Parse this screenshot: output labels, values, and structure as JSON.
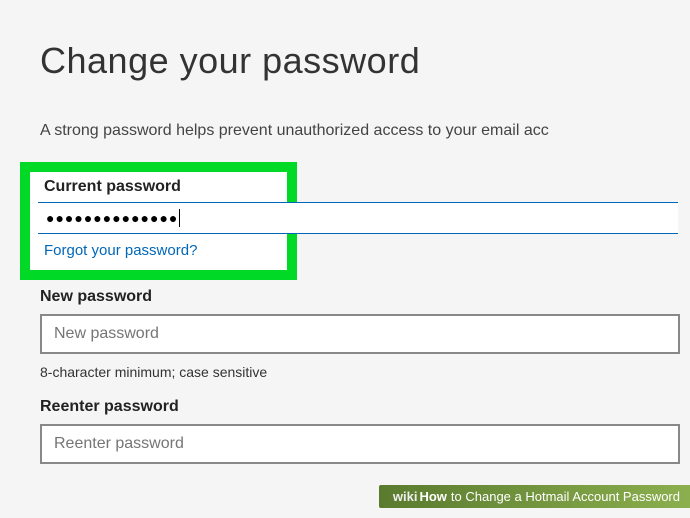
{
  "title": "Change your password",
  "subtitle": "A strong password helps prevent unauthorized access to your email acc",
  "current": {
    "label": "Current password",
    "value": "●●●●●●●●●●●●●●",
    "forgot_link": "Forgot your password?"
  },
  "new": {
    "label": "New password",
    "placeholder": "New password",
    "hint": "8-character minimum; case sensitive"
  },
  "reenter": {
    "label": "Reenter password",
    "placeholder": "Reenter password"
  },
  "banner": {
    "logo_prefix": "wiki",
    "logo_suffix": "How",
    "text": " to Change a Hotmail Account Password"
  }
}
